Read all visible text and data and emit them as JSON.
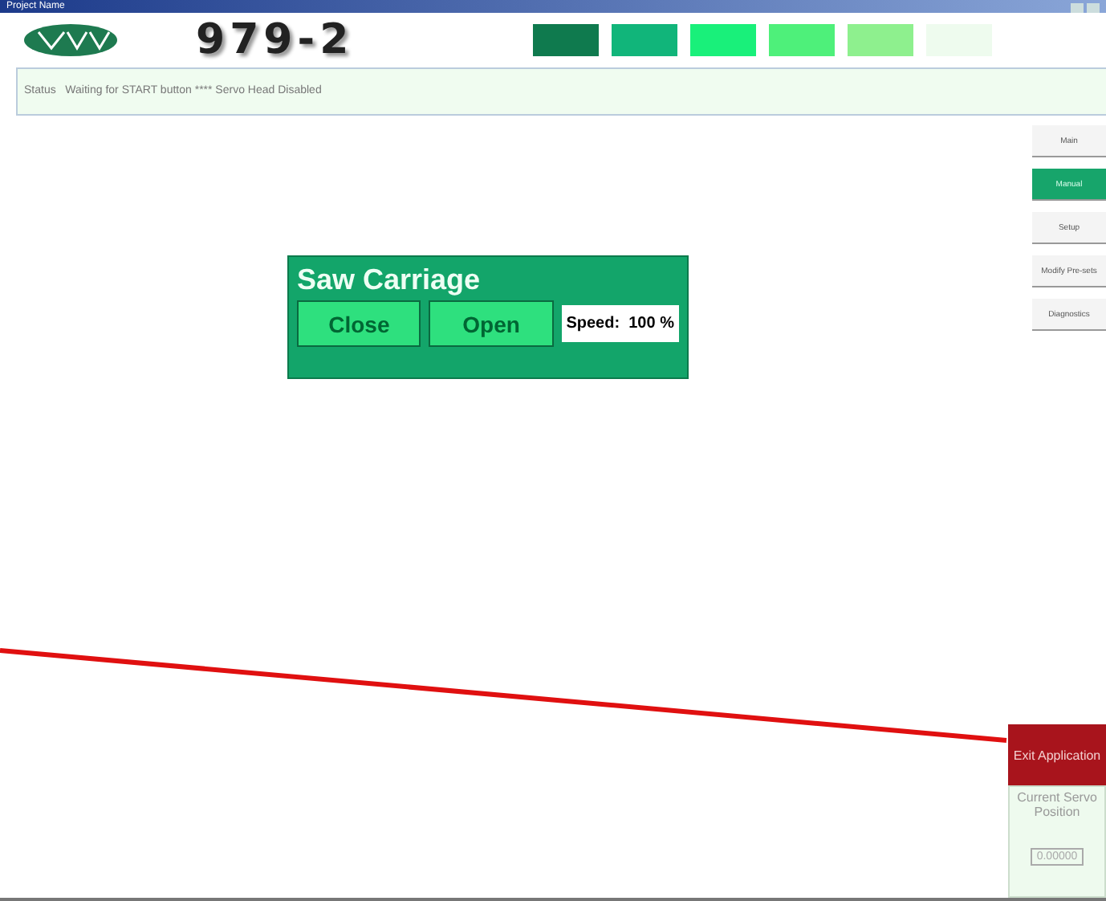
{
  "window": {
    "title": "Project Name"
  },
  "header": {
    "machine": "979-2",
    "swatches": [
      {
        "color": "#0f7a4e"
      },
      {
        "color": "#11b57a"
      },
      {
        "color": "#19f07a"
      },
      {
        "color": "#4ef07a"
      },
      {
        "color": "#8ef08e"
      },
      {
        "color": "#eefbee"
      }
    ]
  },
  "status": {
    "text": "Status   Waiting for START button **** Servo Head Disabled"
  },
  "nav": [
    {
      "label": "Main",
      "selected": false
    },
    {
      "label": "Manual",
      "selected": true
    },
    {
      "label": "Setup",
      "selected": false
    },
    {
      "label": "Modify Pre-sets",
      "selected": false
    },
    {
      "label": "Diagnostics",
      "selected": false
    }
  ],
  "panel": {
    "title": "Saw Carriage",
    "buttons": [
      "Close",
      "Open"
    ],
    "speed": "Speed:  100 %"
  },
  "exit": "Exit Application",
  "servo": {
    "label": "Current Servo Position",
    "value": "0.00000"
  }
}
